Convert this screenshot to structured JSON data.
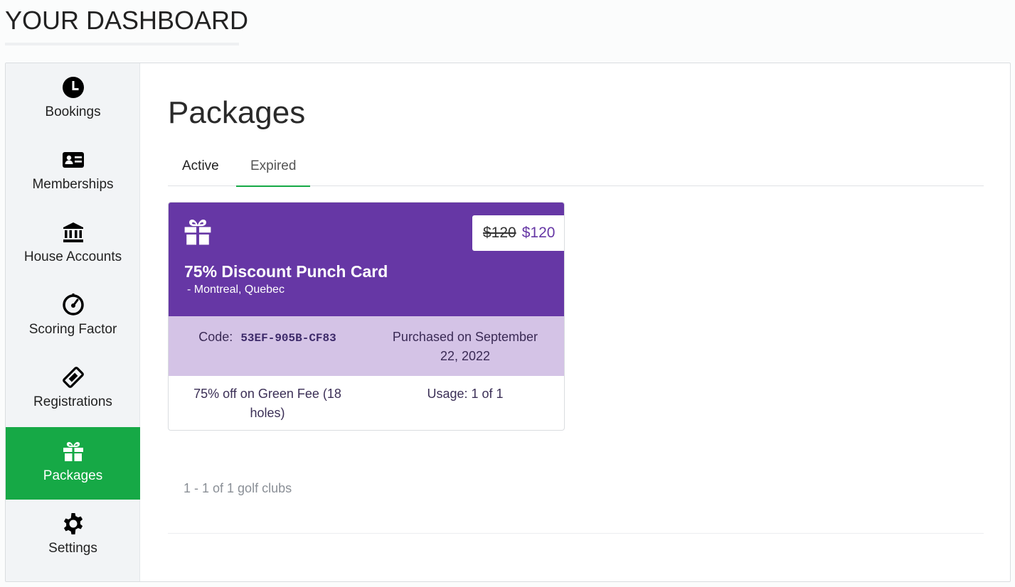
{
  "header": {
    "title": "YOUR DASHBOARD"
  },
  "sidebar": {
    "items": [
      {
        "label": "Bookings",
        "icon": "clock-icon"
      },
      {
        "label": "Memberships",
        "icon": "id-card-icon"
      },
      {
        "label": "House Accounts",
        "icon": "bank-icon"
      },
      {
        "label": "Scoring Factor",
        "icon": "gauge-icon"
      },
      {
        "label": "Registrations",
        "icon": "ticket-icon"
      },
      {
        "label": "Packages",
        "icon": "gift-icon",
        "active": true
      },
      {
        "label": "Settings",
        "icon": "gear-icon"
      }
    ]
  },
  "main": {
    "title": "Packages",
    "tabs": [
      {
        "label": "Active"
      },
      {
        "label": "Expired",
        "selected": true
      }
    ],
    "package": {
      "original_price": "$120",
      "price": "$120",
      "title": "75% Discount Punch Card",
      "location": "-  Montreal, Quebec",
      "code_label": "Code:",
      "code": "53EF-905B-CF83",
      "purchased": "Purchased on September 22, 2022",
      "description": "75% off on Green Fee (18 holes)",
      "usage": "Usage: 1 of 1"
    },
    "pager": "1 - 1 of 1 golf clubs"
  },
  "colors": {
    "accent_green": "#16a946",
    "card_purple": "#6637a5",
    "card_light_purple": "#d4c3e6"
  }
}
